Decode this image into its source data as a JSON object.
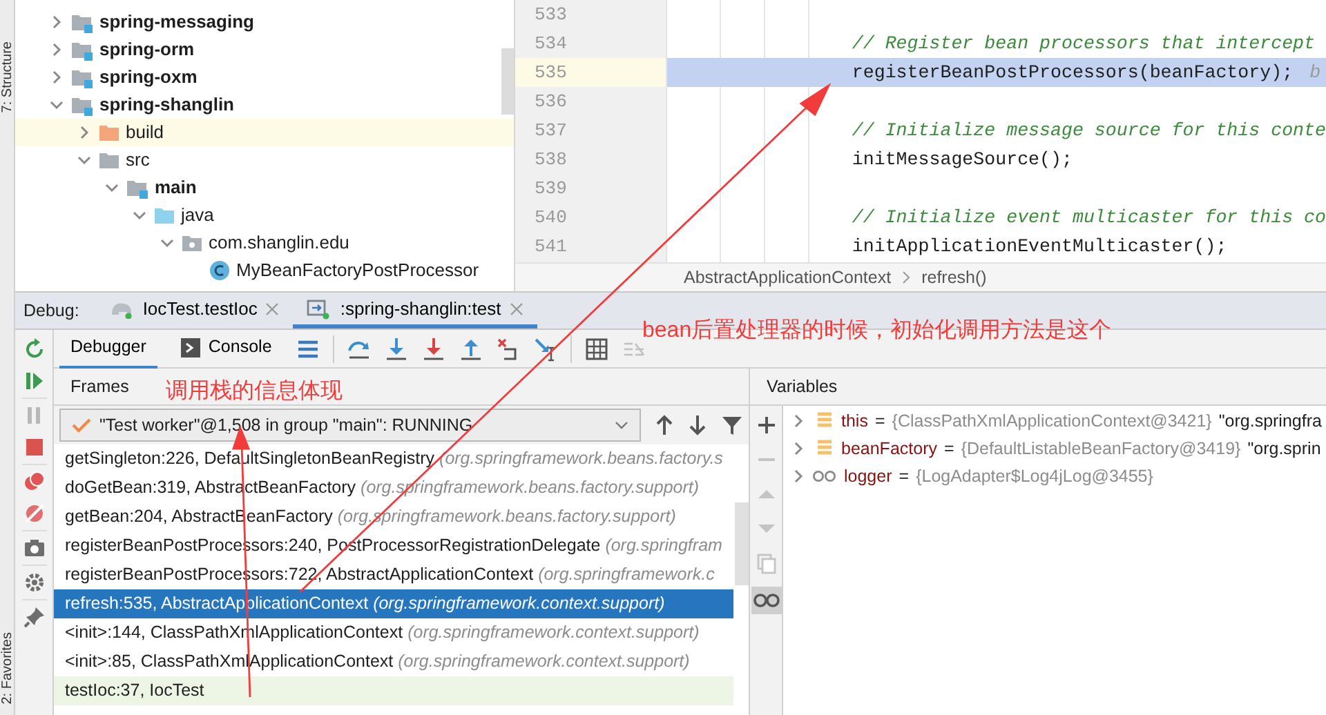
{
  "side_strip": {
    "top_label": "7: Structure",
    "bottom_label": "2: Favorites"
  },
  "project_tree": {
    "items": [
      {
        "label": "spring-messaging",
        "kind": "module",
        "expanded": false,
        "highlighted": false
      },
      {
        "label": "spring-orm",
        "kind": "module",
        "expanded": false,
        "highlighted": false
      },
      {
        "label": "spring-oxm",
        "kind": "module",
        "expanded": false,
        "highlighted": false
      },
      {
        "label": "spring-shanglin",
        "kind": "module",
        "expanded": true,
        "highlighted": false,
        "children": [
          {
            "label": "build",
            "kind": "excluded",
            "expanded": false,
            "highlighted": true
          },
          {
            "label": "src",
            "kind": "folder",
            "expanded": true,
            "highlighted": false,
            "children": [
              {
                "label": "main",
                "kind": "source_set",
                "expanded": true,
                "highlighted": false,
                "children": [
                  {
                    "label": "java",
                    "kind": "sources_root",
                    "expanded": true,
                    "highlighted": false,
                    "children": [
                      {
                        "label": "com.shanglin.edu",
                        "kind": "package",
                        "expanded": true,
                        "highlighted": false,
                        "children": [
                          {
                            "label": "MyBeanFactoryPostProcessor",
                            "kind": "class",
                            "highlighted": false
                          }
                        ]
                      }
                    ]
                  }
                ]
              }
            ]
          }
        ]
      }
    ]
  },
  "editor": {
    "lines": [
      {
        "number": "533"
      },
      {
        "number": "534",
        "kind": "comment",
        "text": "// Register bean processors that intercept",
        "execution_point": false
      },
      {
        "number": "535",
        "kind": "code",
        "text": "registerBeanPostProcessors(beanFactory);",
        "hint": "b",
        "execution_point": true
      },
      {
        "number": "536",
        "execution_point": false
      },
      {
        "number": "537",
        "kind": "comment",
        "text": "// Initialize message source for this conte",
        "execution_point": false
      },
      {
        "number": "538",
        "kind": "code",
        "text": "initMessageSource();",
        "execution_point": false
      },
      {
        "number": "539",
        "execution_point": false
      },
      {
        "number": "540",
        "kind": "comment",
        "text": "// Initialize event multicaster for this co",
        "execution_point": false
      },
      {
        "number": "541",
        "kind": "code",
        "text": "initApplicationEventMulticaster();",
        "execution_point": false
      }
    ],
    "breadcrumb": [
      "AbstractApplicationContext",
      "refresh()"
    ]
  },
  "debug": {
    "title": "Debug:",
    "tabs": [
      {
        "label": "IocTest.testIoc",
        "selected": false
      },
      {
        "label": ":spring-shanglin:test",
        "selected": true
      }
    ],
    "subtabs": [
      {
        "label": "Debugger",
        "selected": true
      },
      {
        "label": "Console",
        "selected": false
      }
    ],
    "frames": {
      "title": "Frames",
      "thread": "\"Test worker\"@1,508 in group \"main\": RUNNING",
      "items": [
        {
          "method": "getSingleton:226, DefaultSingletonBeanRegistry",
          "package": "(org.springframework.beans.factory.s",
          "kind": "library",
          "selected": false
        },
        {
          "method": "doGetBean:319, AbstractBeanFactory",
          "package": "(org.springframework.beans.factory.support)",
          "kind": "library",
          "selected": false
        },
        {
          "method": "getBean:204, AbstractBeanFactory",
          "package": "(org.springframework.beans.factory.support)",
          "kind": "library",
          "selected": false
        },
        {
          "method": "registerBeanPostProcessors:240, PostProcessorRegistrationDelegate",
          "package": "(org.springfram",
          "kind": "library",
          "selected": false
        },
        {
          "method": "registerBeanPostProcessors:722, AbstractApplicationContext",
          "package": "(org.springframework.c",
          "kind": "library",
          "selected": false
        },
        {
          "method": "refresh:535, AbstractApplicationContext",
          "package": "(org.springframework.context.support)",
          "kind": "library",
          "selected": true
        },
        {
          "method": "<init>:144, ClassPathXmlApplicationContext",
          "package": "(org.springframework.context.support)",
          "kind": "library",
          "selected": false
        },
        {
          "method": "<init>:85, ClassPathXmlApplicationContext",
          "package": "(org.springframework.context.support)",
          "kind": "library",
          "selected": false
        },
        {
          "method": "testIoc:37, IocTest",
          "kind": "user",
          "selected": false
        }
      ]
    },
    "variables": {
      "title": "Variables",
      "items": [
        {
          "kind": "field",
          "name": "this",
          "operator": "=",
          "object": "{ClassPathXmlApplicationContext@3421}",
          "value": "\"org.springfra"
        },
        {
          "kind": "field",
          "name": "beanFactory",
          "operator": "=",
          "object": "{DefaultListableBeanFactory@3419}",
          "value": "\"org.sprin"
        },
        {
          "kind": "watch",
          "name": "logger",
          "operator": "=",
          "object": "{LogAdapter$Log4jLog@3455}"
        }
      ]
    }
  },
  "annotations": [
    {
      "text": "bean后置处理器的时候，初始化调用方法是这个"
    },
    {
      "text": "调用栈的信息体现"
    }
  ]
}
